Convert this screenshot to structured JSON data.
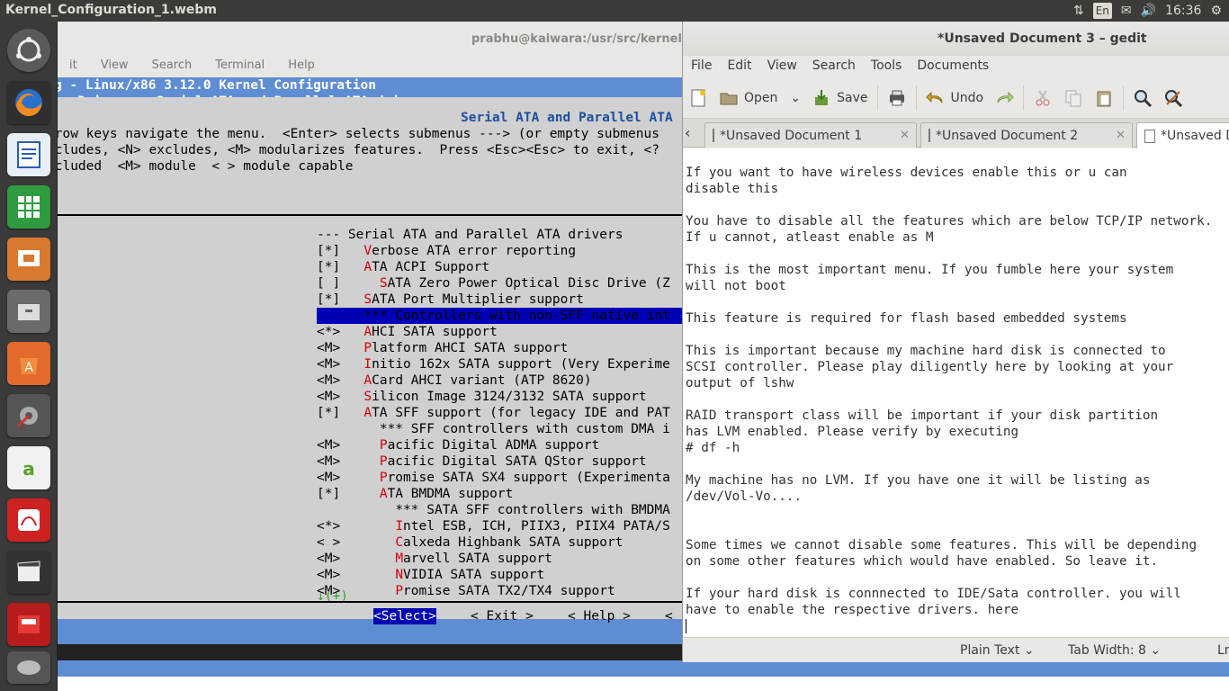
{
  "top_panel": {
    "window_title": "Kernel_Configuration_1.webm",
    "language": "En",
    "time": "16:36"
  },
  "launcher": {
    "items": [
      "ubuntu-dash-icon",
      "firefox-icon",
      "writer-icon",
      "calc-icon",
      "impress-icon",
      "files-icon",
      "software-center-icon",
      "settings-icon",
      "aptana-icon",
      "reader-icon",
      "video-editor-icon",
      "slides-icon",
      "disk-icon"
    ]
  },
  "terminal": {
    "title": "prabhu@kaiwara:/usr/src/kernels",
    "menu": [
      "it",
      "View",
      "Search",
      "Terminal",
      "Help"
    ],
    "header_line1": "g - Linux/x86 3.12.0 Kernel Configuration",
    "header_line2": "ce Drivers → Serial ATA and Parallel ATA drivers ─────────────────────────",
    "box_title": "Serial ATA and Parallel ATA",
    "help_lines": [
      "rrow keys navigate the menu.  <Enter> selects submenus ---> (or empty submenus",
      "ncludes, <N> excludes, <M> modularizes features.  Press <Esc><Esc> to exit, <?",
      "xcluded  <M> module  < > module capable"
    ],
    "menu_items": [
      {
        "prefix": "",
        "text": "--- Serial ATA and Parallel ATA drivers",
        "indent": ""
      },
      {
        "prefix": "[*]",
        "hot": "V",
        "text": "erbose ATA error reporting",
        "indent": ""
      },
      {
        "prefix": "[*]",
        "hot": "A",
        "text": "TA ACPI Support",
        "indent": ""
      },
      {
        "prefix": "[ ]",
        "hot": "S",
        "text": "ATA Zero Power Optical Disc Drive (Z",
        "indent": "  "
      },
      {
        "prefix": "[*]",
        "hot": "S",
        "text": "ATA Port Multiplier support",
        "indent": ""
      },
      {
        "prefix": "",
        "hot": "",
        "text": "*** Controllers with non-SFF native int",
        "indent": "",
        "selected": true
      },
      {
        "prefix": "<*>",
        "hot": "A",
        "text": "HCI SATA support",
        "indent": ""
      },
      {
        "prefix": "<M>",
        "hot": "P",
        "text": "latform AHCI SATA support",
        "indent": ""
      },
      {
        "prefix": "<M>",
        "hot": "I",
        "text": "nitio 162x SATA support (Very Experime",
        "indent": ""
      },
      {
        "prefix": "<M>",
        "hot": "A",
        "text": "Card AHCI variant (ATP 8620)",
        "indent": ""
      },
      {
        "prefix": "<M>",
        "hot": "S",
        "text": "ilicon Image 3124/3132 SATA support",
        "indent": ""
      },
      {
        "prefix": "[*]",
        "hot": "A",
        "text": "TA SFF support (for legacy IDE and PAT",
        "indent": ""
      },
      {
        "prefix": "",
        "hot": "",
        "text": "*** SFF controllers with custom DMA i",
        "indent": "  "
      },
      {
        "prefix": "<M>",
        "hot": "P",
        "text": "acific Digital ADMA support",
        "indent": "  "
      },
      {
        "prefix": "<M>",
        "hot": "P",
        "text": "acific Digital SATA QStor support",
        "indent": "  "
      },
      {
        "prefix": "<M>",
        "hot": "P",
        "text": "romise SATA SX4 support (Experimenta",
        "indent": "  "
      },
      {
        "prefix": "[*]",
        "hot": "A",
        "text": "TA BMDMA support",
        "indent": "  "
      },
      {
        "prefix": "",
        "hot": "",
        "text": "*** SATA SFF controllers with BMDMA",
        "indent": "    "
      },
      {
        "prefix": "<*>",
        "hot": "I",
        "text": "ntel ESB, ICH, PIIX3, PIIX4 PATA/S",
        "indent": "    "
      },
      {
        "prefix": "< >",
        "hot": "C",
        "text": "alxeda Highbank SATA support",
        "indent": "    "
      },
      {
        "prefix": "<M>",
        "hot": "M",
        "text": "arvell SATA support",
        "indent": "    "
      },
      {
        "prefix": "<M>",
        "hot": "N",
        "text": "VIDIA SATA support",
        "indent": "    "
      },
      {
        "prefix": "<M>",
        "hot": "P",
        "text": "romise SATA TX2/TX4 support",
        "indent": "    "
      }
    ],
    "more_marker": "↓(+)",
    "buttons": [
      "<Select>",
      "< Exit >",
      "< Help >",
      "<"
    ]
  },
  "gedit": {
    "title": "*Unsaved Document 3 – gedit",
    "menu": [
      "File",
      "Edit",
      "View",
      "Search",
      "Tools",
      "Documents"
    ],
    "toolbar": {
      "open": "Open",
      "save": "Save",
      "undo": "Undo"
    },
    "tabs": [
      "*Unsaved Document 1",
      "*Unsaved Document 2",
      "*Unsaved D"
    ],
    "text_lines": [
      "If you want to have wireless devices enable this or u can",
      "disable this",
      "",
      "You have to disable all the features which are below TCP/IP network.",
      "If u cannot, atleast enable as M",
      "",
      "This is the most important menu. If you fumble here your system",
      "will not boot",
      "",
      "This feature is required for flash based embedded systems",
      "",
      "This is important because my machine hard disk is connected to",
      "SCSI controller. Please play diligently here by looking at your",
      "output of lshw",
      "",
      "RAID transport class will be important if your disk partition",
      "has LVM enabled. Please verify by executing",
      "# df -h",
      "",
      "My machine has no LVM. If you have one it will be listing as",
      "/dev/Vol-Vo....",
      "",
      "",
      "Some times we cannot disable some features. This will be depending",
      "on some other features which would have enabled. So leave it.",
      "",
      "If your hard disk is connnected to IDE/Sata controller. you will",
      "have to enable the respective drivers. here"
    ],
    "status": {
      "syntax": "Plain Text",
      "tab_width": "Tab Width:  8",
      "ln": "Ln"
    }
  }
}
